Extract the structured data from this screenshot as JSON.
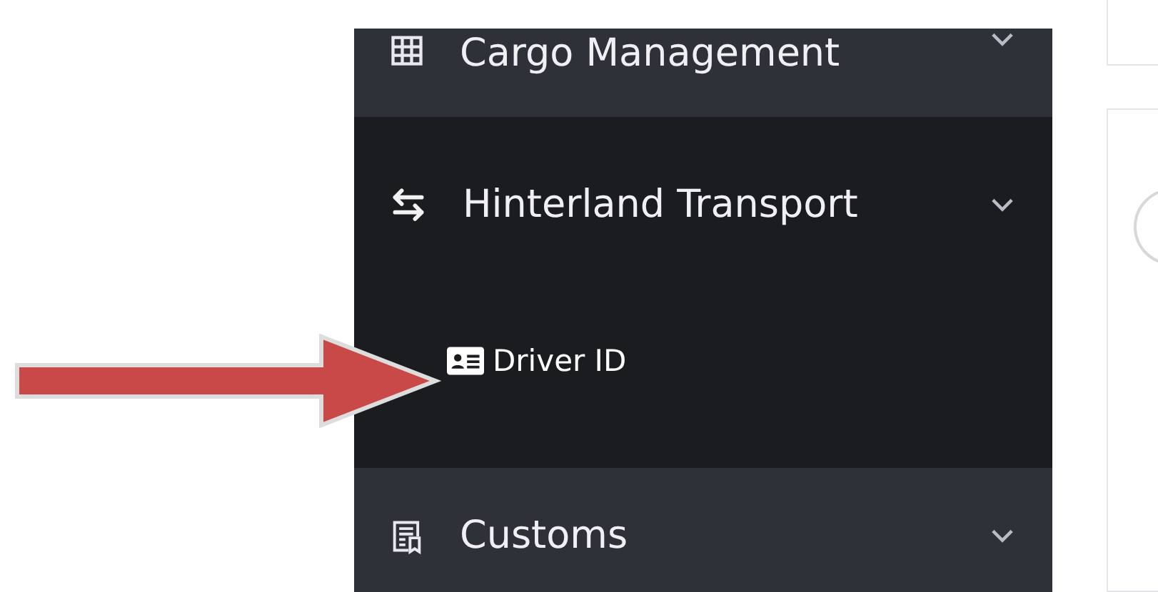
{
  "sidebar": {
    "items": [
      {
        "label": "Cargo Management",
        "expanded": false
      },
      {
        "label": "Hinterland Transport",
        "expanded": true,
        "children": [
          {
            "label": "Driver ID"
          }
        ]
      },
      {
        "label": "Customs",
        "expanded": false
      }
    ]
  },
  "annotation": {
    "kind": "arrow"
  }
}
